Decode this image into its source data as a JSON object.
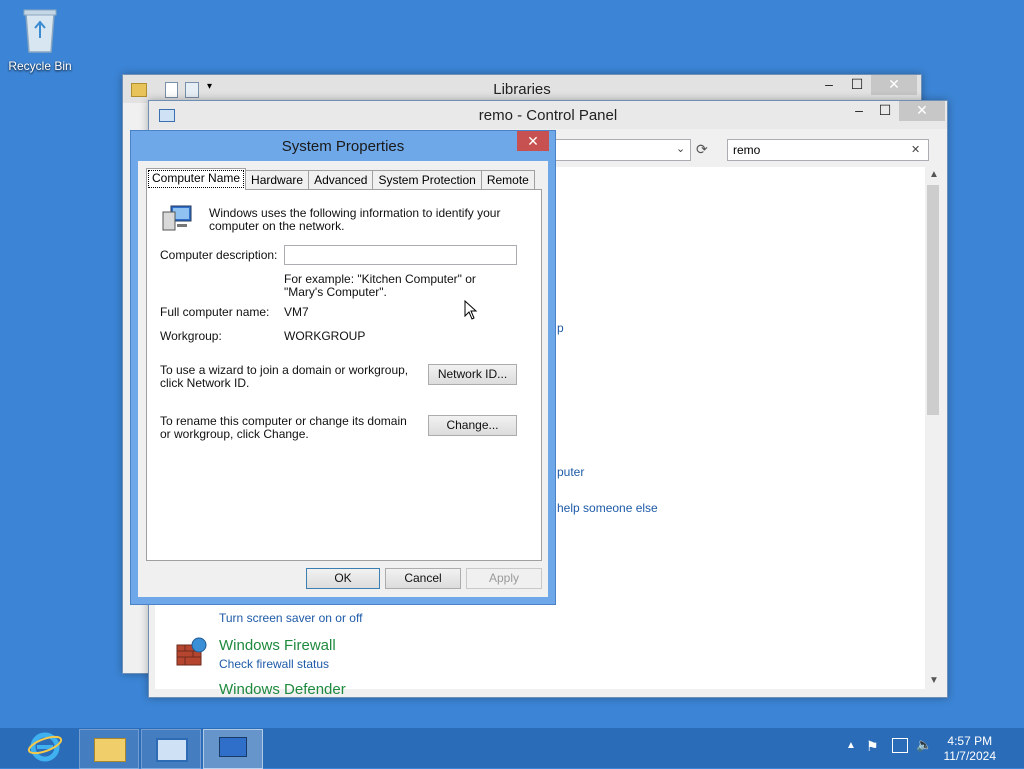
{
  "desktop": {
    "recycle_bin_label": "Recycle Bin"
  },
  "libraries_window": {
    "title": "Libraries",
    "minimize": "–",
    "maximize": "☐",
    "close": "✕"
  },
  "control_panel_window": {
    "title": "remo - Control Panel",
    "search_value": "remo",
    "search_clear": "✕",
    "minimize": "–",
    "maximize": "☐",
    "close": "✕",
    "partial_links": [
      "p",
      "puter",
      "help someone else"
    ],
    "items": [
      {
        "link": "Turn screen saver on or off"
      },
      {
        "heading": "Windows Firewall",
        "link": "Check firewall status"
      },
      {
        "heading": "Windows Defender"
      }
    ]
  },
  "system_properties": {
    "title": "System Properties",
    "close": "✕",
    "tabs": [
      "Computer Name",
      "Hardware",
      "Advanced",
      "System Protection",
      "Remote"
    ],
    "intro": "Windows uses the following information to identify your computer on the network.",
    "description_label": "Computer description:",
    "description_value": "",
    "example": "For example: \"Kitchen Computer\" or \"Mary's Computer\".",
    "full_name_label": "Full computer name:",
    "full_name_value": "VM7",
    "workgroup_label": "Workgroup:",
    "workgroup_value": "WORKGROUP",
    "network_text": "To use a wizard to join a domain or workgroup, click Network ID.",
    "network_button": "Network ID...",
    "rename_text": "To rename this computer or change its domain or workgroup, click Change.",
    "change_button": "Change...",
    "ok": "OK",
    "cancel": "Cancel",
    "apply": "Apply"
  },
  "taskbar": {
    "time": "4:57 PM",
    "date": "11/7/2024"
  }
}
